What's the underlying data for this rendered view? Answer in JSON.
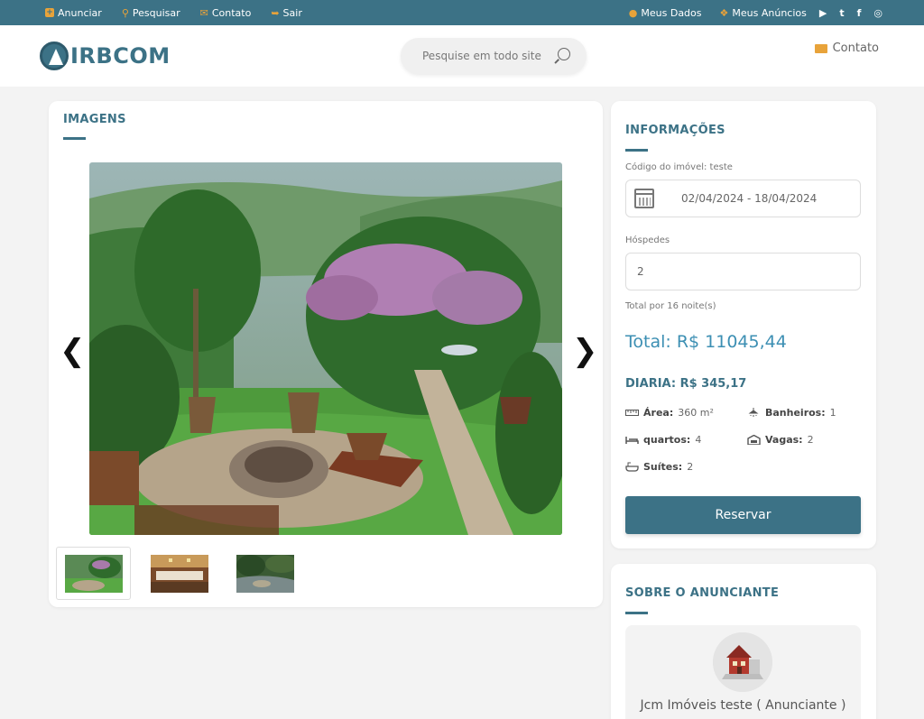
{
  "topbar": {
    "left": [
      {
        "label": "Anunciar",
        "icon": "plus-square-icon"
      },
      {
        "label": "Pesquisar",
        "icon": "search-icon"
      },
      {
        "label": "Contato",
        "icon": "envelope-icon"
      },
      {
        "label": "Sair",
        "icon": "sign-out-icon"
      }
    ],
    "right": [
      {
        "label": "Meus Dados",
        "icon": "user-icon"
      },
      {
        "label": "Meus Anúncios",
        "icon": "cubes-icon"
      }
    ],
    "social": [
      "youtube-icon",
      "twitter-icon",
      "facebook-icon",
      "instagram-icon"
    ]
  },
  "header": {
    "logo_text": "IRBCOM",
    "search_placeholder": "Pesquise em todo site",
    "contact_label": "Contato"
  },
  "images": {
    "title": "IMAGENS",
    "prev_label": "❮",
    "next_label": "❯",
    "thumbnail_count": 3
  },
  "info": {
    "title": "INFORMAÇÕES",
    "code_label": "Código do imóvel: teste",
    "date_range": "02/04/2024 - 18/04/2024",
    "guests_label": "Hóspedes",
    "guests_value": "2",
    "total_note": "Total por 16 noite(s)",
    "total": "Total: R$ 11045,44",
    "daily": "DIARIA: R$ 345,17",
    "features": {
      "area_label": "Área:",
      "area_value": "360 m²",
      "bath_label": "Banheiros:",
      "bath_value": "1",
      "rooms_label": "quartos:",
      "rooms_value": "4",
      "parking_label": "Vagas:",
      "parking_value": "2",
      "suites_label": "Suítes:",
      "suites_value": "2"
    },
    "reserve_label": "Reservar"
  },
  "advertiser": {
    "title": "SOBRE O ANUNCIANTE",
    "name": "Jcm Imóveis teste ( Anunciante )"
  },
  "colors": {
    "primary": "#3c7286",
    "accent": "#e8a33a",
    "total_blue": "#3c8fb3",
    "background": "#f3f3f3"
  }
}
